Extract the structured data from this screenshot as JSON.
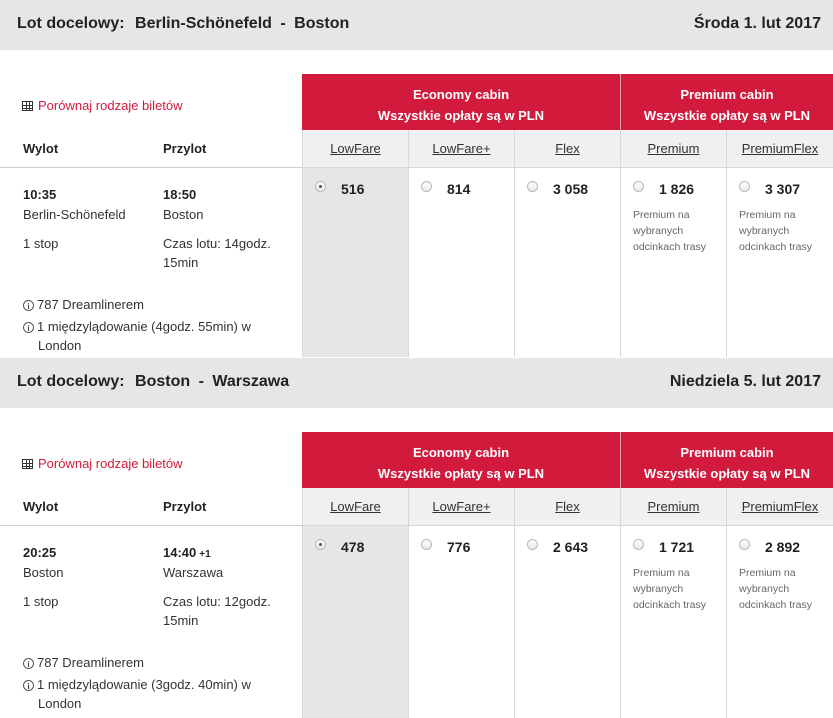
{
  "flights": [
    {
      "route_label": "Lot docelowy:",
      "origin": "Berlin-Schönefeld",
      "destination": "Boston",
      "route_separator": "-",
      "date": "Środa 1. lut 2017",
      "compare_link": "Porównaj rodzaje biletów",
      "economy": {
        "title": "Economy cabin",
        "subtitle": "Wszystkie opłaty są w PLN"
      },
      "premium": {
        "title": "Premium cabin",
        "subtitle": "Wszystkie opłaty są w PLN"
      },
      "headers": {
        "departure": "Wylot",
        "arrival": "Przylot"
      },
      "departure_time": "10:35",
      "departure_city": "Berlin-Schönefeld",
      "arrival_time": "18:50",
      "arrival_day_offset": "",
      "arrival_city": "Boston",
      "stops": "1 stop",
      "duration_line1": "Czas lotu: 14godz.",
      "duration_line2": "15min",
      "aircraft": "787 Dreamlinerem",
      "layover_line1": "1 międzylądowanie (4godz. 55min) w",
      "layover_line2": "London",
      "fares": [
        {
          "name": "LowFare",
          "price": "516",
          "selected": true,
          "note": ""
        },
        {
          "name": "LowFare+",
          "price": "814",
          "selected": false,
          "note": ""
        },
        {
          "name": "Flex",
          "price": "3 058",
          "selected": false,
          "note": ""
        },
        {
          "name": "Premium",
          "price": "1 826",
          "selected": false,
          "note": "Premium na wybranych odcinkach trasy"
        },
        {
          "name": "PremiumFlex",
          "price": "3 307",
          "selected": false,
          "note": "Premium na wybranych odcinkach trasy"
        }
      ]
    },
    {
      "route_label": "Lot docelowy:",
      "origin": "Boston",
      "destination": "Warszawa",
      "route_separator": "-",
      "date": "Niedziela 5. lut 2017",
      "compare_link": "Porównaj rodzaje biletów",
      "economy": {
        "title": "Economy cabin",
        "subtitle": "Wszystkie opłaty są w PLN"
      },
      "premium": {
        "title": "Premium cabin",
        "subtitle": "Wszystkie opłaty są w PLN"
      },
      "headers": {
        "departure": "Wylot",
        "arrival": "Przylot"
      },
      "departure_time": "20:25",
      "departure_city": "Boston",
      "arrival_time": "14:40",
      "arrival_day_offset": "+1",
      "arrival_city": "Warszawa",
      "stops": "1 stop",
      "duration_line1": "Czas lotu: 12godz.",
      "duration_line2": "15min",
      "aircraft": "787 Dreamlinerem",
      "layover_line1": "1 międzylądowanie (3godz. 40min) w",
      "layover_line2": "London",
      "fares": [
        {
          "name": "LowFare",
          "price": "478",
          "selected": true,
          "note": ""
        },
        {
          "name": "LowFare+",
          "price": "776",
          "selected": false,
          "note": ""
        },
        {
          "name": "Flex",
          "price": "2 643",
          "selected": false,
          "note": ""
        },
        {
          "name": "Premium",
          "price": "1 721",
          "selected": false,
          "note": "Premium na wybranych odcinkach trasy"
        },
        {
          "name": "PremiumFlex",
          "price": "2 892",
          "selected": false,
          "note": "Premium na wybranych odcinkach trasy"
        }
      ]
    }
  ],
  "colors": {
    "accent": "#d21a3c",
    "header_bg": "#e6e6e6",
    "selected_bg": "#e6e6e6"
  },
  "icons": {
    "compare": "grid-icon",
    "info": "info-icon",
    "radio": "radio-button"
  }
}
